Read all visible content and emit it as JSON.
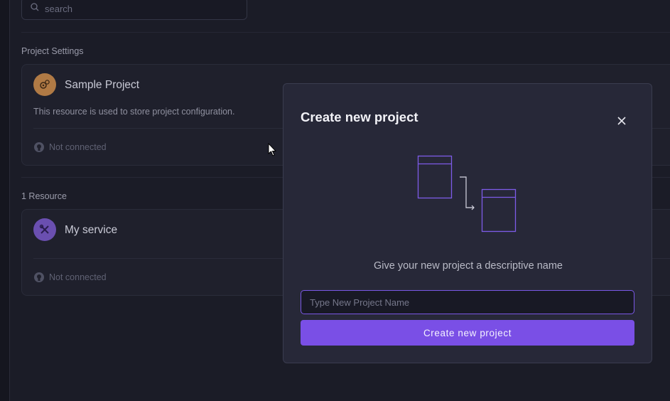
{
  "search": {
    "placeholder": "search",
    "icon": "search-icon"
  },
  "project_settings": {
    "section_label": "Project Settings",
    "card": {
      "avatar_icon": "gears-icon",
      "avatar_color": "#b07a45",
      "title": "Sample Project",
      "description": "This resource is used to store project configuration.",
      "status": "Not connected",
      "status_icon": "github-icon"
    }
  },
  "resources": {
    "section_label": "1 Resource",
    "card": {
      "avatar_icon": "tools-icon",
      "avatar_color": "#6a4fb0",
      "title": "My service",
      "status": "Not connected",
      "status_icon": "github-icon"
    }
  },
  "modal": {
    "title": "Create new project",
    "close_icon": "close-icon",
    "illustration": "project-windows-illustration",
    "subtitle": "Give your new project a descriptive name",
    "input_placeholder": "Type New Project Name",
    "input_value": "",
    "button_label": "Create new project",
    "accent_color": "#7a4fe6"
  }
}
